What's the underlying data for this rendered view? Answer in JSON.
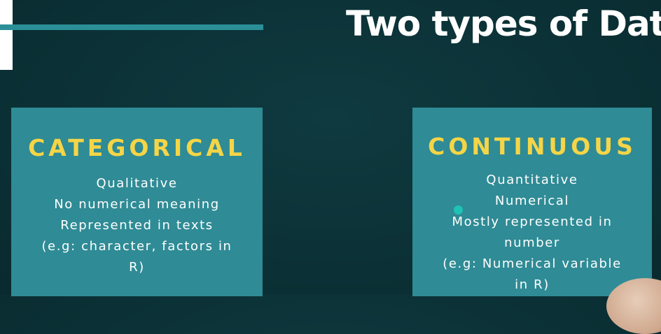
{
  "slide": {
    "title": "Two types of Data"
  },
  "cards": {
    "categorical": {
      "heading": "CATEGORICAL",
      "lines": [
        "Qualitative",
        "No numerical meaning",
        "Represented in texts",
        "(e.g: character, factors in",
        "R)"
      ]
    },
    "continuous": {
      "heading": "CONTINUOUS",
      "lines": [
        "Quantitative",
        "Numerical",
        "Mostly represented in",
        "number",
        "(e.g: Numerical variable",
        "in R)"
      ]
    }
  },
  "colors": {
    "background": "#0d3338",
    "card": "#2f8b95",
    "heading": "#f5d547",
    "accent_line": "#2b8f98",
    "cursor_highlight": "#1fc3b6"
  }
}
